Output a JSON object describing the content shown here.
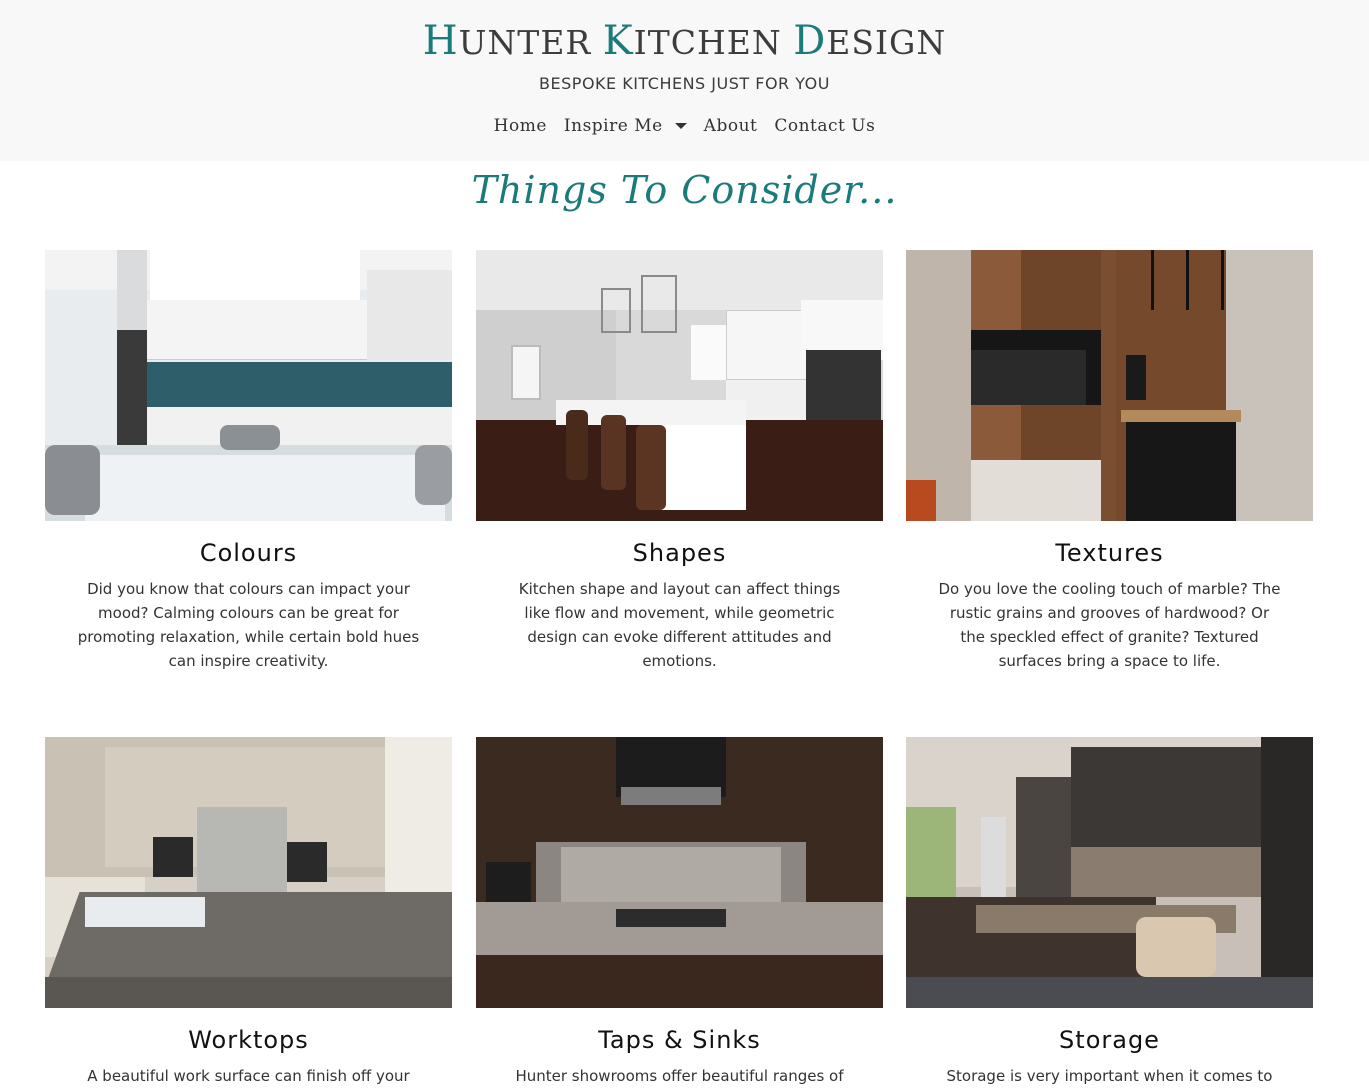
{
  "header": {
    "brand_words": [
      {
        "cap": "H",
        "rest": "UNTER"
      },
      {
        "cap": "K",
        "rest": "ITCHEN"
      },
      {
        "cap": "D",
        "rest": "ESIGN"
      }
    ],
    "tagline": "BESPOKE KITCHENS JUST FOR YOU",
    "nav": {
      "home": "Home",
      "inspire": "Inspire Me",
      "about": "About",
      "contact": "Contact Us"
    }
  },
  "section_title": "Things To Consider...",
  "cards": [
    {
      "title": "Colours",
      "text": "Did you know that colours can impact your mood? Calming colours can be great for promoting relaxation, while certain bold hues can inspire creativity."
    },
    {
      "title": "Shapes",
      "text": "Kitchen shape and layout can affect things like flow and movement, while geometric design can evoke different attitudes and emotions."
    },
    {
      "title": "Textures",
      "text": "Do you love the cooling touch of marble? The rustic grains and grooves of hardwood? Or the speckled effect of granite? Textured surfaces bring a space to life."
    },
    {
      "title": "Worktops",
      "text": "A beautiful work surface can finish off your"
    },
    {
      "title": "Taps & Sinks",
      "text": "Hunter showrooms offer beautiful ranges of"
    },
    {
      "title": "Storage",
      "text": "Storage is very important when it comes to"
    }
  ],
  "colors": {
    "accent": "#1b7a7a",
    "header_bg": "#f8f8f8"
  }
}
